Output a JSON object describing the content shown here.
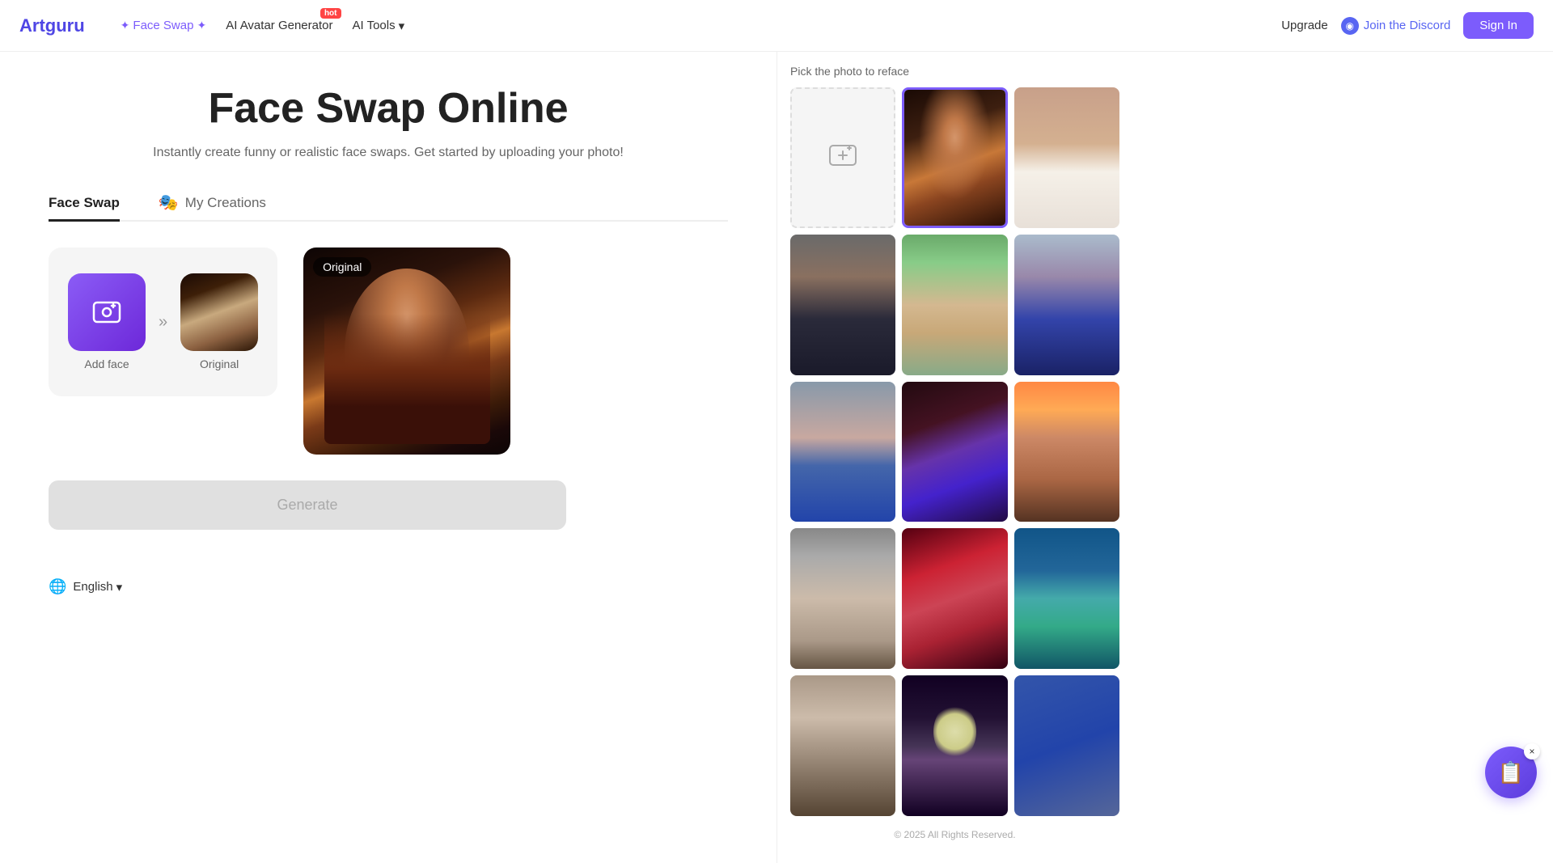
{
  "navbar": {
    "logo_text": "Artguru",
    "nav_items": [
      {
        "id": "face-swap",
        "label": "Face Swap",
        "active": true,
        "badge": null,
        "has_star": true
      },
      {
        "id": "ai-avatar",
        "label": "AI Avatar Generator",
        "active": false,
        "badge": "hot",
        "has_star": false
      },
      {
        "id": "ai-tools",
        "label": "AI Tools",
        "active": false,
        "badge": null,
        "has_star": false,
        "has_chevron": true
      }
    ],
    "upgrade_label": "Upgrade",
    "discord_label": "Join the Discord",
    "signin_label": "Sign In"
  },
  "hero": {
    "title": "Face Swap Online",
    "subtitle": "Instantly create funny or realistic face swaps. Get started by uploading your photo!"
  },
  "tabs": [
    {
      "id": "face-swap",
      "label": "Face Swap",
      "emoji": null,
      "active": true
    },
    {
      "id": "my-creations",
      "label": "My Creations",
      "emoji": "🎭",
      "active": false
    }
  ],
  "swap_area": {
    "add_face_label": "Add face",
    "original_label": "Original",
    "original_badge": "Original"
  },
  "generate_button": {
    "label": "Generate"
  },
  "footer": {
    "language_label": "English"
  },
  "right_panel": {
    "title": "Pick the photo to reface",
    "photos": [
      {
        "id": "upload",
        "type": "upload"
      },
      {
        "id": "p1",
        "type": "image",
        "class": "p1",
        "selected": true
      },
      {
        "id": "p2",
        "type": "image",
        "class": "p2"
      },
      {
        "id": "p3",
        "type": "image",
        "class": "p3"
      },
      {
        "id": "p4",
        "type": "image",
        "class": "p4"
      },
      {
        "id": "p5",
        "type": "image",
        "class": "p5"
      },
      {
        "id": "p6",
        "type": "image",
        "class": "p6"
      },
      {
        "id": "p7",
        "type": "image",
        "class": "p7"
      },
      {
        "id": "p8",
        "type": "image",
        "class": "p8"
      },
      {
        "id": "p9",
        "type": "image",
        "class": "p9"
      },
      {
        "id": "p10",
        "type": "image",
        "class": "p10"
      },
      {
        "id": "p11",
        "type": "image",
        "class": "p11"
      },
      {
        "id": "p12",
        "type": "image",
        "class": "p12"
      }
    ]
  },
  "icons": {
    "star": "✦",
    "chevron_down": "▾",
    "globe": "🌐",
    "discord": "◉",
    "upload_plus": "⊞",
    "add_photo": "⊞",
    "chat": "📋",
    "arrow": "»",
    "close": "×"
  }
}
